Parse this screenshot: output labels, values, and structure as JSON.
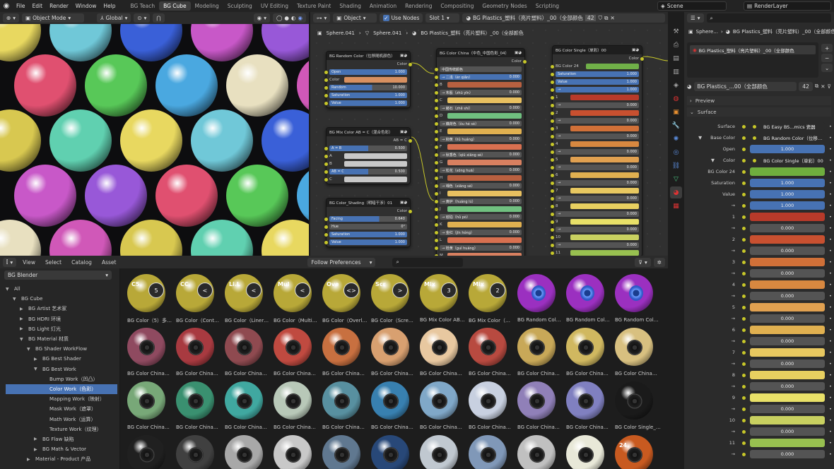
{
  "menu": {
    "file": "File",
    "edit": "Edit",
    "render": "Render",
    "window": "Window",
    "help": "Help"
  },
  "workspaces": [
    "BG Teach",
    "BG Cube",
    "Modeling",
    "Sculpting",
    "UV Editing",
    "Texture Paint",
    "Shading",
    "Animation",
    "Rendering",
    "Compositing",
    "Geometry Nodes",
    "Scripting"
  ],
  "scene": "Scene",
  "render_layer": "RenderLayer",
  "viewport": {
    "mode": "Object Mode",
    "orientation": "Global"
  },
  "node_header": {
    "type": "Object",
    "use_nodes": "Use Nodes",
    "slot": "Slot 1",
    "material": "BG Plastics_塑料（亮片塑料）_00（全部颜色",
    "users": "42"
  },
  "breadcrumb": {
    "obj": "Sphere.041",
    "mesh": "Sphere.041",
    "mat": "BG Plastics_塑料（亮片塑料）_00（全部颜色"
  },
  "node_random": {
    "title": "BG Random Color（位移随机颜色）",
    "out": "Color",
    "rows": [
      {
        "l": "Open",
        "v": "1.000"
      },
      {
        "l": "Color",
        "v": ""
      },
      {
        "l": "Random",
        "v": "10.000"
      },
      {
        "l": "Saturation",
        "v": "1.000"
      },
      {
        "l": "Value",
        "v": "1.000"
      }
    ]
  },
  "node_mix": {
    "title": "BG Mix Color AB = C（混合色彩）",
    "out": "AB = C",
    "rows": [
      {
        "l": "A = B",
        "v": "0.500"
      },
      {
        "l": "A",
        "v": ""
      },
      {
        "l": "B",
        "v": ""
      },
      {
        "l": "AB = C",
        "v": "0.500"
      },
      {
        "l": "C",
        "v": ""
      }
    ]
  },
  "node_shading": {
    "title": "BG Color_Shading（明暗干涉）01",
    "out": "Color",
    "rows": [
      {
        "l": "Facing",
        "v": "0.640"
      },
      {
        "l": "Hue",
        "v": "0°"
      },
      {
        "l": "Saturation",
        "v": "1.000"
      },
      {
        "l": "Value",
        "v": "1.000"
      }
    ]
  },
  "node_china": {
    "title": "BG Color China（中色_中国色彩_04）",
    "out": "Color",
    "rows": [
      "中国传统颜色",
      "→ 二浅（èr qiǎn）",
      "B",
      "→ 朱殷（zhū yīn）",
      "C",
      "→ 赭石（zhě shí）",
      "D",
      "→ 藕荷色（ǒu hé sè）",
      "E",
      "→ 柳黄（liǔ huáng）",
      "F",
      "→ 秋香色（qiū xiāng sè）",
      "G",
      "→ 松花（sōng huā）",
      "H",
      "→ 缃色（xiāng sè）",
      "I",
      "→ 黄栌（huáng lú）",
      "J",
      "→ 琥珀（hǔ pò）",
      "K",
      "→ 金红（jīn hóng）",
      "L",
      "→ 桂黄（guì huáng）",
      "M"
    ],
    "val": "0.000"
  },
  "node_single": {
    "title": "BG Color Single（单彩）00",
    "out": "Color",
    "rows": [
      {
        "l": "BG Color 24",
        "v": ""
      },
      {
        "l": "Saturation",
        "v": "1.000"
      },
      {
        "l": "Value",
        "v": "1.000"
      },
      {
        "l": "→",
        "v": "1.000"
      },
      {
        "l": "1",
        "v": ""
      },
      {
        "l": "→",
        "v": "0.000"
      },
      {
        "l": "2",
        "v": ""
      },
      {
        "l": "→",
        "v": "0.000"
      },
      {
        "l": "3",
        "v": ""
      },
      {
        "l": "→",
        "v": "0.000"
      },
      {
        "l": "4",
        "v": ""
      },
      {
        "l": "→",
        "v": "0.000"
      },
      {
        "l": "5",
        "v": ""
      },
      {
        "l": "→",
        "v": "0.000"
      },
      {
        "l": "6",
        "v": ""
      },
      {
        "l": "→",
        "v": "0.000"
      },
      {
        "l": "7",
        "v": ""
      },
      {
        "l": "→",
        "v": "0.000"
      },
      {
        "l": "8",
        "v": ""
      },
      {
        "l": "→",
        "v": "0.000"
      },
      {
        "l": "9",
        "v": ""
      },
      {
        "l": "→",
        "v": "0.000"
      },
      {
        "l": "10",
        "v": ""
      },
      {
        "l": "→",
        "v": "0.000"
      },
      {
        "l": "11",
        "v": ""
      }
    ]
  },
  "asset_browser": {
    "view": "View",
    "select": "Select",
    "catalog": "Catalog",
    "asset": "Asset",
    "library": "BG Blender",
    "import": "Follow Preferences"
  },
  "tree": [
    {
      "d": 0,
      "t": "▼",
      "l": "All"
    },
    {
      "d": 1,
      "t": "▼",
      "l": "BG Cube"
    },
    {
      "d": 2,
      "t": "▶",
      "l": "BG Artist 艺术家"
    },
    {
      "d": 2,
      "t": "▶",
      "l": "BG HDRI 环境"
    },
    {
      "d": 2,
      "t": "▶",
      "l": "BG Light 灯光"
    },
    {
      "d": 2,
      "t": "▼",
      "l": "BG Material 材质"
    },
    {
      "d": 3,
      "t": "▼",
      "l": "BG Shader WorkFlow"
    },
    {
      "d": 4,
      "t": "▶",
      "l": "BG Best Shader"
    },
    {
      "d": 4,
      "t": "▼",
      "l": "BG Best Work"
    },
    {
      "d": 5,
      "t": "",
      "l": "Bump Work（凹凸）"
    },
    {
      "d": 5,
      "t": "",
      "l": "Color Work（色彩）",
      "sel": true
    },
    {
      "d": 5,
      "t": "",
      "l": "Mapping Work（映射）"
    },
    {
      "d": 5,
      "t": "",
      "l": "Mask Work（遮罩）"
    },
    {
      "d": 5,
      "t": "",
      "l": "Math Work（运算）"
    },
    {
      "d": 5,
      "t": "",
      "l": "Texture Work（纹理）"
    },
    {
      "d": 4,
      "t": "▶",
      "l": "BG Flaw 缺陷"
    },
    {
      "d": 4,
      "t": "▶",
      "l": "BG Math & Vector"
    },
    {
      "d": 3,
      "t": "▶",
      "l": "Material - Product 产品"
    }
  ],
  "assets": [
    {
      "l": "BG Color（5）多…",
      "c": "#b8a838",
      "g": "5",
      "tg": "C5"
    },
    {
      "l": "BG Color（Cont…",
      "c": "#b8a838",
      "g": "<",
      "tg": "CC"
    },
    {
      "l": "BG Color（Liner…",
      "c": "#b8a838",
      "g": "<",
      "tg": "Li.L"
    },
    {
      "l": "BG Color（Multi…",
      "c": "#b8a838",
      "g": "<",
      "tg": "Mul"
    },
    {
      "l": "BG Color（Overl…",
      "c": "#b8a838",
      "g": "<>",
      "tg": "Ove"
    },
    {
      "l": "BG Color（Scre…",
      "c": "#b8a838",
      "g": ">",
      "tg": "Scr"
    },
    {
      "l": "BG Mix Color AB…",
      "c": "#b8a838",
      "g": "3",
      "tg": "Mix"
    },
    {
      "l": "BG Mix Color（…",
      "c": "#b8a838",
      "g": "2",
      "tg": "Mix"
    },
    {
      "l": "BG Random Col…",
      "c": "#9b30c0",
      "dot": true
    },
    {
      "l": "BG Random Col…",
      "c": "#9b30c0",
      "dot": true
    },
    {
      "l": "BG Random Col…",
      "c": "#9b30c0",
      "dot": true
    },
    {
      "l": "BG Color China…",
      "c": "#8f4a60"
    },
    {
      "l": "BG Color China…",
      "c": "#a83a40"
    },
    {
      "l": "BG Color China…",
      "c": "#8f4a50"
    },
    {
      "l": "BG Color China…",
      "c": "#c04a40"
    },
    {
      "l": "BG Color China…",
      "c": "#c87040"
    },
    {
      "l": "BG Color China…",
      "c": "#d8a070"
    },
    {
      "l": "BG Color China…",
      "c": "#e8c8a0"
    },
    {
      "l": "BG Color China…",
      "c": "#b84a40"
    },
    {
      "l": "BG Color China…",
      "c": "#c8a858"
    },
    {
      "l": "BG Color China…",
      "c": "#d0b860"
    },
    {
      "l": "BG Color China…",
      "c": "#d8c080"
    },
    {
      "l": "BG Color China…",
      "c": "#78a878"
    },
    {
      "l": "BG Color China…",
      "c": "#3a9070"
    },
    {
      "l": "BG Color China…",
      "c": "#40a8a0"
    },
    {
      "l": "BG Color China…",
      "c": "#b8c8b8"
    },
    {
      "l": "BG Color China…",
      "c": "#5890a0"
    },
    {
      "l": "BG Color China…",
      "c": "#3880b0"
    },
    {
      "l": "BG Color China…",
      "c": "#80a8c8"
    },
    {
      "l": "BG Color China…",
      "c": "#c8d0e0"
    },
    {
      "l": "BG Color China…",
      "c": "#9080b8"
    },
    {
      "l": "BG Color China…",
      "c": "#8080c0"
    },
    {
      "l": "BG Color Single_…",
      "c": "#1a1a1a"
    },
    {
      "l": "",
      "c": "#202020"
    },
    {
      "l": "",
      "c": "#404040"
    },
    {
      "l": "",
      "c": "#a8a8a8"
    },
    {
      "l": "",
      "c": "#c8c8c8"
    },
    {
      "l": "",
      "c": "#607890"
    },
    {
      "l": "",
      "c": "#284878"
    },
    {
      "l": "",
      "c": "#c0c8d0"
    },
    {
      "l": "",
      "c": "#8098b8"
    },
    {
      "l": "",
      "c": "#c0c0c0"
    },
    {
      "l": "",
      "c": "#e8e8d8"
    },
    {
      "l": "",
      "c": "#c85a20",
      "tg": "24"
    }
  ],
  "properties": {
    "obj": "Sphere...",
    "mat": "BG Plastics_塑料（亮片塑料）_00（全部颜色",
    "slot_mat": "BG Plastics_塑料（亮片塑料）_00（全部颜色",
    "mat2": "BG Plastics_...00（全部颜色",
    "users": "42",
    "preview": "Preview",
    "surface_panel": "Surface",
    "rows": [
      {
        "l": "Surface",
        "v": "BG Easy BS...mics 瓷器",
        "k": "link"
      },
      {
        "l": "Base Color",
        "v": "BG Random Color（位移…",
        "k": "link",
        "t": "▼"
      },
      {
        "l": "Open",
        "v": "1.000",
        "k": "blue"
      },
      {
        "l": "Color",
        "v": "BG Color Single（单彩）00",
        "k": "link",
        "t": "▼"
      },
      {
        "l": "BG Color 24",
        "c": "#6fae3e",
        "k": "sw"
      },
      {
        "l": "Saturation",
        "v": "1.000",
        "k": "blue"
      },
      {
        "l": "Value",
        "v": "1.000",
        "k": "blue"
      },
      {
        "l": "→",
        "v": "1.000",
        "k": "blue"
      },
      {
        "l": "1",
        "c": "#b83a2a",
        "k": "sw"
      },
      {
        "l": "→",
        "v": "0.000",
        "k": "f"
      },
      {
        "l": "2",
        "c": "#c85030",
        "k": "sw"
      },
      {
        "l": "→",
        "v": "0.000",
        "k": "f"
      },
      {
        "l": "3",
        "c": "#d07038",
        "k": "sw"
      },
      {
        "l": "→",
        "v": "0.000",
        "k": "f"
      },
      {
        "l": "4",
        "c": "#d88840",
        "k": "sw"
      },
      {
        "l": "→",
        "v": "0.000",
        "k": "f"
      },
      {
        "l": "5",
        "c": "#e0a050",
        "k": "sw"
      },
      {
        "l": "→",
        "v": "0.000",
        "k": "f"
      },
      {
        "l": "6",
        "c": "#e0b050",
        "k": "sw"
      },
      {
        "l": "→",
        "v": "0.000",
        "k": "f"
      },
      {
        "l": "7",
        "c": "#e8c860",
        "k": "sw"
      },
      {
        "l": "→",
        "v": "0.000",
        "k": "f"
      },
      {
        "l": "8",
        "c": "#e8d060",
        "k": "sw"
      },
      {
        "l": "→",
        "v": "0.000",
        "k": "f"
      },
      {
        "l": "9",
        "c": "#e8e068",
        "k": "sw"
      },
      {
        "l": "→",
        "v": "0.000",
        "k": "f"
      },
      {
        "l": "10",
        "c": "#c8d060",
        "k": "sw"
      },
      {
        "l": "→",
        "v": "0.000",
        "k": "f"
      },
      {
        "l": "11",
        "c": "#98c050",
        "k": "sw"
      },
      {
        "l": "→",
        "v": "0.000",
        "k": "f"
      }
    ]
  }
}
